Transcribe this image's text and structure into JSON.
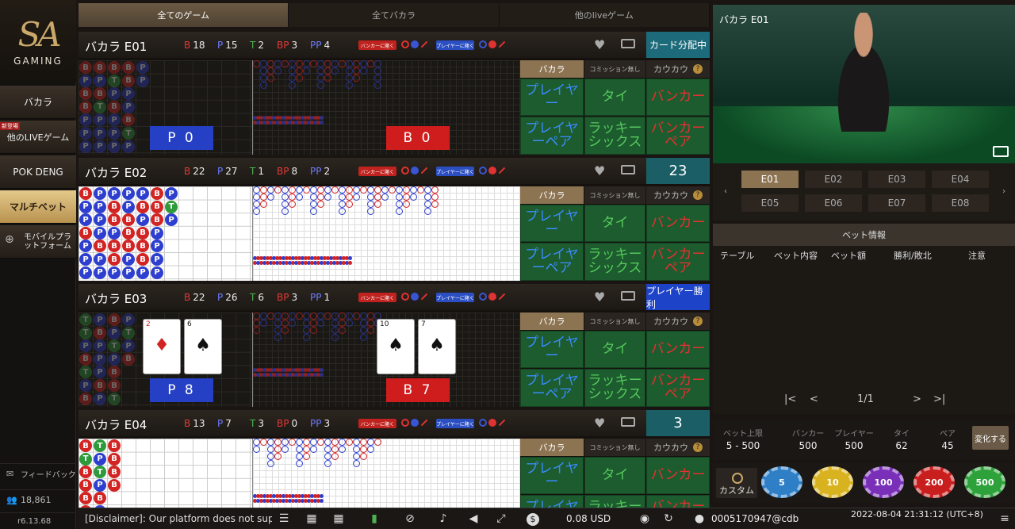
{
  "sidebar": {
    "logo_text": "SA",
    "logo_sub": "GAMING",
    "items": [
      {
        "label": "バカラ"
      },
      {
        "label": "他のLIVEゲーム",
        "badge": "新登場"
      },
      {
        "label": "POK DENG"
      },
      {
        "label": "マルチベット"
      },
      {
        "label": "モバイルプラットフォーム"
      }
    ],
    "feedback": "フィードバック",
    "online": "18,861",
    "version": "r6.13.68"
  },
  "tabs": [
    "全てのゲーム",
    "全てバカラ",
    "他のliveゲーム"
  ],
  "tables": [
    {
      "name": "バカラ E01",
      "b": "18",
      "p": "15",
      "t": "2",
      "bp": "3",
      "pp": "4",
      "status": "カード分配中",
      "score_p": "P 0",
      "score_b": "B 0"
    },
    {
      "name": "バカラ E02",
      "b": "22",
      "p": "27",
      "t": "1",
      "bp": "8",
      "pp": "2",
      "status": "23"
    },
    {
      "name": "バカラ E03",
      "b": "22",
      "p": "26",
      "t": "6",
      "bp": "3",
      "pp": "1",
      "status": "プレイヤー勝利",
      "score_p": "P 8",
      "score_b": "B 7",
      "cards_p": [
        {
          "v": "2",
          "s": "♦"
        },
        {
          "v": "6",
          "s": "♠"
        }
      ],
      "cards_b": [
        {
          "v": "10",
          "s": "♠"
        },
        {
          "v": "7",
          "s": "♠"
        }
      ]
    },
    {
      "name": "バカラ E04",
      "b": "13",
      "p": "7",
      "t": "3",
      "bp": "0",
      "pp": "3",
      "status": "3"
    }
  ],
  "labels": {
    "b": "B",
    "p": "P",
    "t": "T",
    "bp": "BP",
    "pp": "PP",
    "banker_pill": "バンカーに賭く",
    "player_pill": "プレイヤーに賭く",
    "baccarat": "バカラ",
    "no_commission": "コミッション無し",
    "kaukau": "カウカウ",
    "player": "プレイヤー",
    "tie": "タイ",
    "banker": "バンカー",
    "player_pair": "プレイヤーペア",
    "lucky_six": "ラッキーシックス",
    "banker_pair": "バンカーペア"
  },
  "video": {
    "title": "バカラ E01"
  },
  "table_buttons": [
    "E01",
    "E02",
    "E03",
    "E04",
    "E05",
    "E06",
    "E07",
    "E08"
  ],
  "bet_info": {
    "title": "ベット情報",
    "columns": [
      "テーブル",
      "ベット内容",
      "ベット額",
      "勝利/敗北",
      "注意"
    ],
    "page": "1/1"
  },
  "limits": [
    {
      "label": "ベット上限",
      "value": "5 - 500"
    },
    {
      "label": "バンカー",
      "value": "500"
    },
    {
      "label": "プレイヤー",
      "value": "500"
    },
    {
      "label": "タイ",
      "value": "62"
    },
    {
      "label": "ペア",
      "value": "45"
    }
  ],
  "change_label": "変化する",
  "custom_label": "カスタム",
  "chips": [
    {
      "value": "5",
      "color": "#2f7fc7"
    },
    {
      "value": "10",
      "color": "#d9b21f"
    },
    {
      "value": "100",
      "color": "#7a2fb8"
    },
    {
      "value": "200",
      "color": "#c81e1e"
    },
    {
      "value": "500",
      "color": "#2da13a"
    }
  ],
  "bottom": {
    "disclaimer": "[Disclaimer]: Our platform does not sup",
    "balance": "0.08 USD",
    "user": "0005170947@cdb",
    "datetime": "2022-08-04  21:31:12 (UTC+8)"
  }
}
